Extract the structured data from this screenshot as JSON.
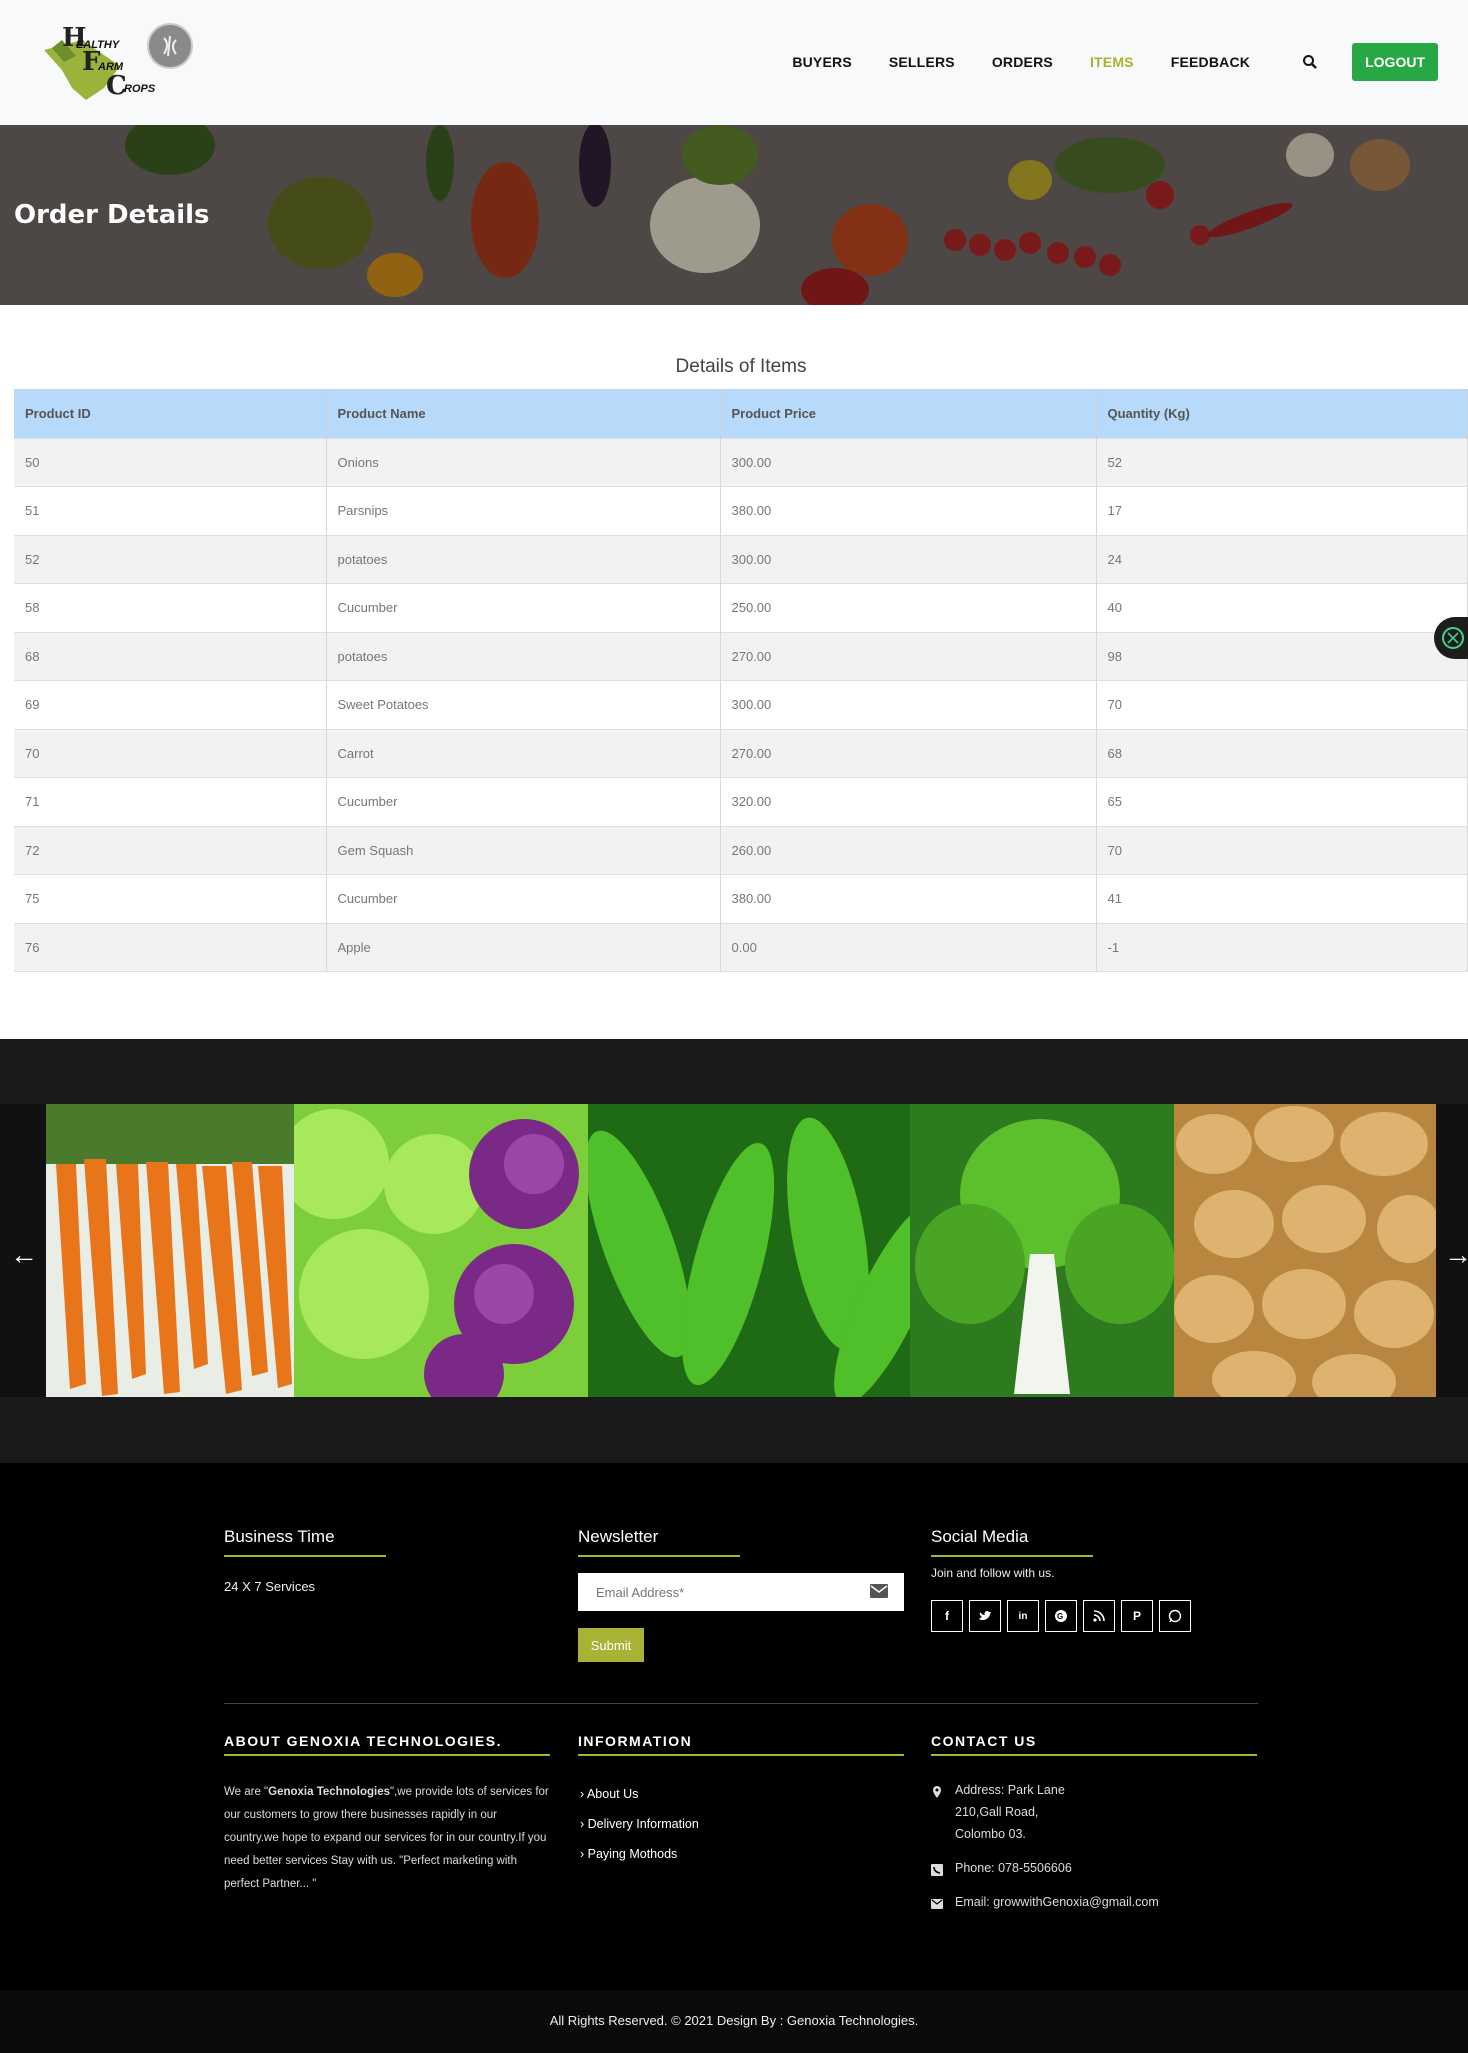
{
  "header": {
    "logo_text": [
      "EALTHY",
      "ARM",
      "ROPS"
    ],
    "nav": [
      "BUYERS",
      "SELLERS",
      "ORDERS",
      "ITEMS",
      "FEEDBACK"
    ],
    "active_nav": "ITEMS",
    "logout_label": "LOGOUT",
    "accent": "#a9b234",
    "logout_color": "#28a745"
  },
  "hero": {
    "title": "Order Details"
  },
  "table": {
    "caption": "Details of Items",
    "headers": [
      "Product ID",
      "Product Name",
      "Product Price",
      "Quantity (Kg)"
    ],
    "rows": [
      [
        "50",
        "Onions",
        "300.00",
        "52"
      ],
      [
        "51",
        "Parsnips",
        "380.00",
        "17"
      ],
      [
        "52",
        "potatoes",
        "300.00",
        "24"
      ],
      [
        "58",
        "Cucumber",
        "250.00",
        "40"
      ],
      [
        "68",
        "potatoes",
        "270.00",
        "98"
      ],
      [
        "69",
        "Sweet Potatoes",
        "300.00",
        "70"
      ],
      [
        "70",
        "Carrot",
        "270.00",
        "68"
      ],
      [
        "71",
        "Cucumber",
        "320.00",
        "65"
      ],
      [
        "72",
        "Gem Squash",
        "260.00",
        "70"
      ],
      [
        "75",
        "Cucumber",
        "380.00",
        "41"
      ],
      [
        "76",
        "Apple",
        "0.00",
        "-1"
      ]
    ]
  },
  "footer": {
    "business_heading": "Business Time",
    "business_text": "24 X 7 Services",
    "newsletter_heading": "Newsletter",
    "email_placeholder": "Email Address*",
    "submit_label": "Submit",
    "social_heading": "Social Media",
    "social_text": "Join and follow with us.",
    "social_icons": [
      "facebook-icon",
      "twitter-icon",
      "linkedin-icon",
      "google-plus-icon",
      "rss-icon",
      "pinterest-icon",
      "whatsapp-icon"
    ],
    "about_heading": "ABOUT GENOXIA TECHNOLOGIES.",
    "about_prefix": "We are \"",
    "about_bold": "Genoxia Technologies",
    "about_rest": "\",we provide lots of services for our customers to grow there businesses rapidly in our country.we hope to expand our services for in our country.If you need better services Stay with us. \"Perfect marketing with perfect Partner... \"",
    "info_heading": "INFORMATION",
    "info_links": [
      "About Us",
      "Delivery Information",
      "Paying Mothods"
    ],
    "contact_heading": "CONTACT US",
    "address_lines": [
      "Address: Park Lane",
      "210,Gall Road,",
      "Colombo 03."
    ],
    "phone": "Phone: 078-5506606",
    "email": "Email: growwithGenoxia@gmail.com",
    "copyright": "All Rights Reserved. © 2021 Design By : Genoxia Technologies."
  }
}
